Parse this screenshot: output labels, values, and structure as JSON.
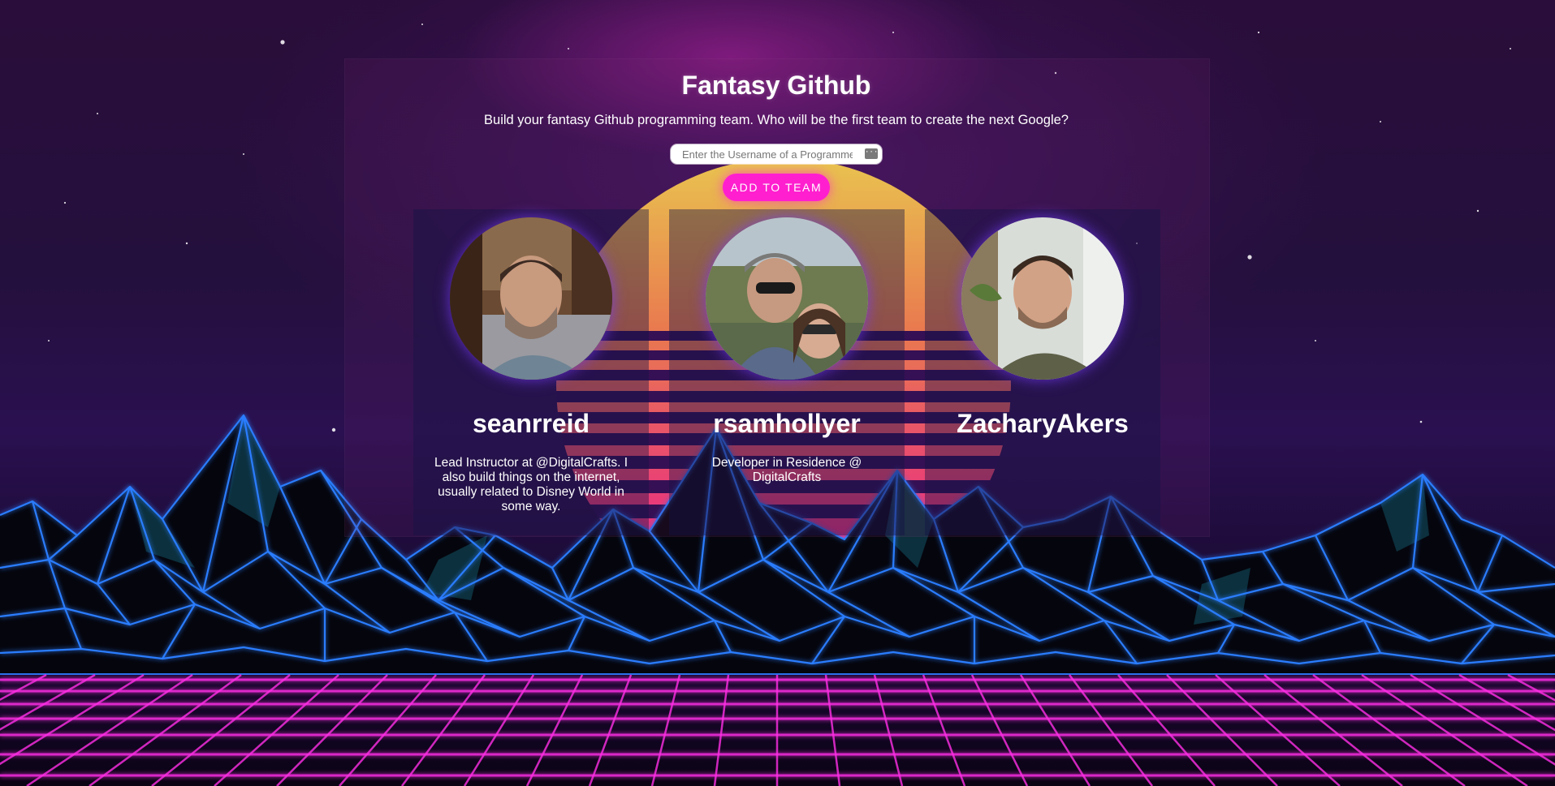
{
  "page": {
    "title": "Fantasy Github",
    "subtitle": "Build your fantasy Github programming team. Who will be the first team to create the next Google?"
  },
  "search": {
    "placeholder": "Enter the Username of a Programmer",
    "value": "",
    "icon": "autofill-key-icon"
  },
  "add_button": {
    "label": "ADD TO TEAM"
  },
  "team": [
    {
      "username": "seanrreid",
      "bio": "Lead Instructor at @DigitalCrafts. I also build things on the internet, usually related to Disney World in some way."
    },
    {
      "username": "rsamhollyer",
      "bio": "Developer in Residence @ DigitalCrafts"
    },
    {
      "username": "ZacharyAkers",
      "bio": ""
    }
  ],
  "colors": {
    "accent": "#ff1fcf",
    "mountain_line": "#2a7dff",
    "grid_line": "#ff2fe6",
    "sun_top": "#ffd84a",
    "sun_bottom": "#ff2f86"
  }
}
